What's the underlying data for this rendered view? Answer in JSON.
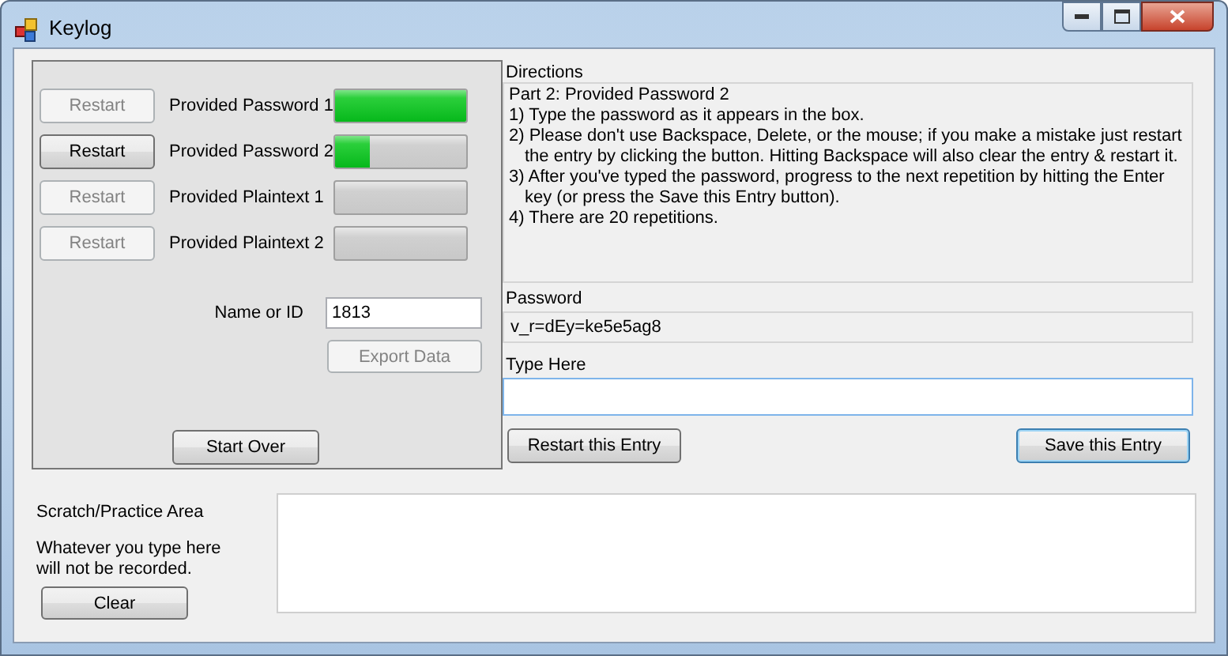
{
  "window": {
    "title": "Keylog"
  },
  "progress_rows": [
    {
      "button": "Restart",
      "disabled": true,
      "label": "Provided Password 1",
      "level": 1.0
    },
    {
      "button": "Restart",
      "disabled": false,
      "label": "Provided Password 2",
      "level": 0.26
    },
    {
      "button": "Restart",
      "disabled": true,
      "label": "Provided Plaintext 1"
    },
    {
      "button": "Restart",
      "disabled": true,
      "label": "Provided Plaintext 2"
    }
  ],
  "name_field": {
    "label": "Name or ID",
    "value": "1813"
  },
  "export_button": {
    "label": "Export Data",
    "disabled": true
  },
  "start_over_button": {
    "label": "Start Over"
  },
  "directions": {
    "label": "Directions",
    "title": "Part 2: Provided Password 2",
    "steps": [
      "1) Type the password as it appears in the box.",
      "2) Please don't use Backspace, Delete, or the mouse; if you make a mistake just restart the entry by clicking the button.  Hitting Backspace will also clear the entry & restart it.",
      "3) After you've typed the password, progress to the next repetition by hitting the Enter key (or press the Save this Entry button).",
      "4) There are 20 repetitions."
    ]
  },
  "password": {
    "label": "Password",
    "value": "v_r=dEy=ke5e5ag8"
  },
  "type_here": {
    "label": "Type Here"
  },
  "restart_entry_button": {
    "label": "Restart this Entry"
  },
  "save_entry_button": {
    "label": "Save this Entry",
    "focused": true
  },
  "scratch": {
    "title": "Scratch/Practice Area",
    "note": "Whatever you type here will not be recorded.",
    "clear_button": "Clear"
  }
}
